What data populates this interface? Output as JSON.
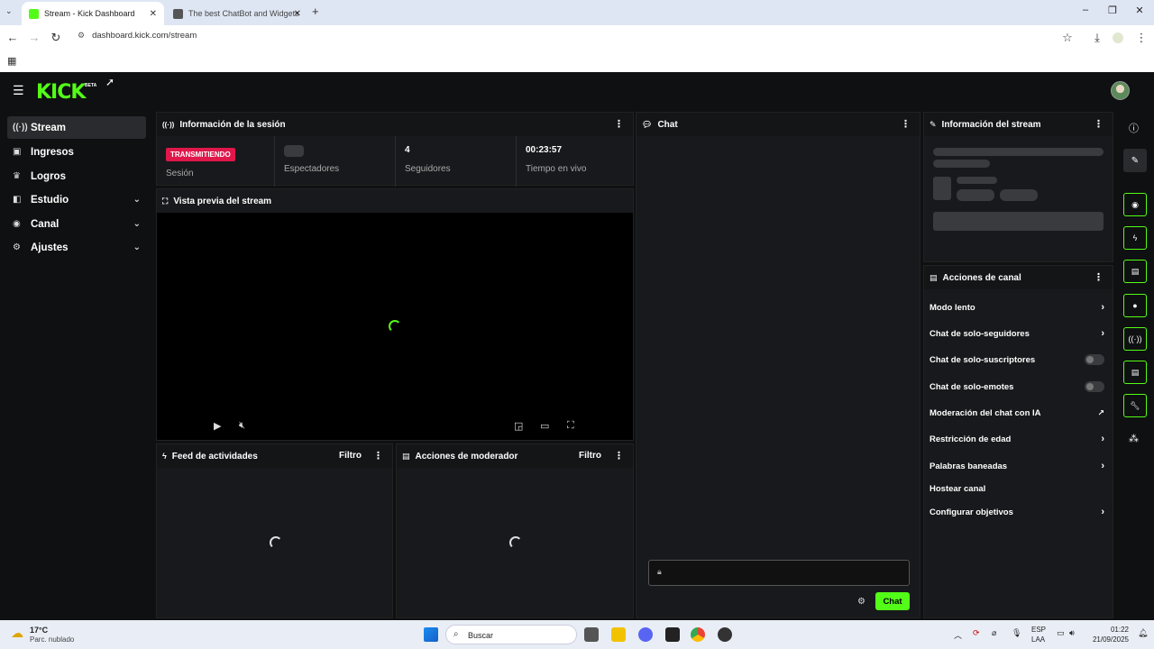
{
  "browser": {
    "tabs": [
      {
        "title": "Stream - Kick Dashboard",
        "active": true
      },
      {
        "title": "The best ChatBot and Widgets",
        "active": false
      }
    ],
    "url": "dashboard.kick.com/stream"
  },
  "header": {
    "logo": "KICK",
    "beta": "BETA"
  },
  "sidebar": {
    "items": [
      {
        "label": "Stream",
        "icon": "broadcast-icon",
        "selected": true
      },
      {
        "label": "Ingresos",
        "icon": "wallet-icon"
      },
      {
        "label": "Logros",
        "icon": "trophy-icon"
      },
      {
        "label": "Estudio",
        "icon": "studio-icon",
        "expandable": true
      },
      {
        "label": "Canal",
        "icon": "channel-icon",
        "expandable": true
      },
      {
        "label": "Ajustes",
        "icon": "gear-icon",
        "expandable": true
      }
    ]
  },
  "session": {
    "title": "Información de la sesión",
    "status_badge": "TRANSMITIENDO",
    "status_label": "Sesión",
    "viewers_label": "Espectadores",
    "followers_value": "4",
    "followers_label": "Seguidores",
    "live_time_value": "00:23:57",
    "live_time_label": "Tiempo en vivo"
  },
  "preview": {
    "title": "Vista previa del stream"
  },
  "activity": {
    "title": "Feed de actividades",
    "filter": "Filtro"
  },
  "moderator": {
    "title": "Acciones de moderador",
    "filter": "Filtro"
  },
  "chat": {
    "title": "Chat",
    "send_label": "Chat"
  },
  "stream_info": {
    "title": "Información del stream"
  },
  "channel_actions": {
    "title": "Acciones de canal",
    "items": [
      {
        "label": "Modo lento",
        "control": "arrow"
      },
      {
        "label": "Chat de solo-seguidores",
        "control": "arrow"
      },
      {
        "label": "Chat de solo-suscriptores",
        "control": "toggle"
      },
      {
        "label": "Chat de solo-emotes",
        "control": "toggle"
      },
      {
        "label": "Moderación del chat con IA",
        "control": "external"
      },
      {
        "label": "Restricción de edad",
        "control": "arrow"
      },
      {
        "label": "Palabras baneadas",
        "control": "arrow"
      },
      {
        "label": "Hostear canal",
        "control": "none"
      },
      {
        "label": "Configurar objetivos",
        "control": "arrow"
      }
    ]
  },
  "taskbar": {
    "weather_temp": "17°C",
    "weather_desc": "Parc. nublado",
    "search": "Buscar",
    "lang_top": "ESP",
    "lang_bottom": "LAA",
    "time": "01:22",
    "date": "21/09/2025"
  },
  "colors": {
    "accent": "#53fc18",
    "live": "#e0174a"
  }
}
